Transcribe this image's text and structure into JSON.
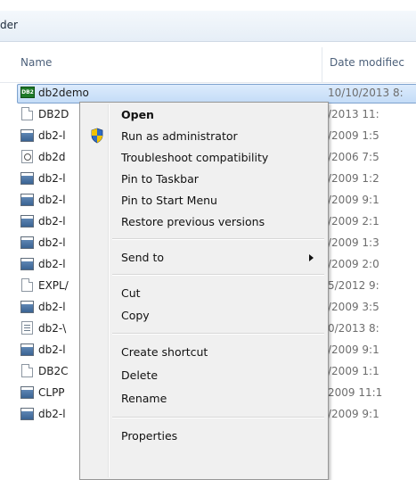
{
  "breadcrumb": {
    "text": "der"
  },
  "columns": {
    "name": "Name",
    "date_modified": "Date modifiec"
  },
  "files": [
    {
      "icon": "db2-app-icon",
      "kind": "db2",
      "name": "db2demo",
      "date": "10/10/2013 8:",
      "selected": true
    },
    {
      "icon": "document-icon",
      "kind": "doc",
      "name": "DB2D",
      "date": "/2013 11:"
    },
    {
      "icon": "application-icon",
      "kind": "exe",
      "name": "db2-l",
      "date": "/2009 1:5"
    },
    {
      "icon": "settings-file-icon",
      "kind": "cfg",
      "name": "db2d",
      "date": "/2006 7:5"
    },
    {
      "icon": "application-icon",
      "kind": "exe",
      "name": "db2-l",
      "date": "/2009 1:2"
    },
    {
      "icon": "application-icon",
      "kind": "exe",
      "name": "db2-l",
      "date": "/2009 9:1"
    },
    {
      "icon": "application-icon",
      "kind": "exe",
      "name": "db2-l",
      "date": "/2009 2:1"
    },
    {
      "icon": "application-icon",
      "kind": "exe",
      "name": "db2-l",
      "date": "/2009 1:3"
    },
    {
      "icon": "application-icon",
      "kind": "exe",
      "name": "db2-l",
      "date": "/2009 2:0"
    },
    {
      "icon": "document-icon",
      "kind": "doc",
      "name": "EXPL/",
      "date": "5/2012 9:"
    },
    {
      "icon": "application-icon",
      "kind": "exe",
      "name": "db2-l",
      "date": "/2009 3:5"
    },
    {
      "icon": "text-file-icon",
      "kind": "txt",
      "name": "db2-\\",
      "date": "0/2013 8:"
    },
    {
      "icon": "application-icon",
      "kind": "exe",
      "name": "db2-l",
      "date": "/2009 9:1"
    },
    {
      "icon": "document-icon",
      "kind": "doc",
      "name": "DB2C",
      "date": "/2009 1:1"
    },
    {
      "icon": "application-icon",
      "kind": "exe",
      "name": "CLPP",
      "date": "2009 11:1"
    },
    {
      "icon": "application-icon",
      "kind": "exe",
      "name": "db2-l",
      "date": "/2009 9:1"
    }
  ],
  "context_menu": {
    "open": "Open",
    "run_as_admin": "Run as administrator",
    "troubleshoot": "Troubleshoot compatibility",
    "pin_taskbar": "Pin to Taskbar",
    "pin_start": "Pin to Start Menu",
    "restore_versions": "Restore previous versions",
    "send_to": "Send to",
    "cut": "Cut",
    "copy": "Copy",
    "create_shortcut": "Create shortcut",
    "delete": "Delete",
    "rename": "Rename",
    "properties": "Properties"
  },
  "colors": {
    "selection": "#cce8ff",
    "menu_bg": "#f0f0f0",
    "shield_blue": "#2f6cc4",
    "shield_yellow": "#f2c200"
  }
}
